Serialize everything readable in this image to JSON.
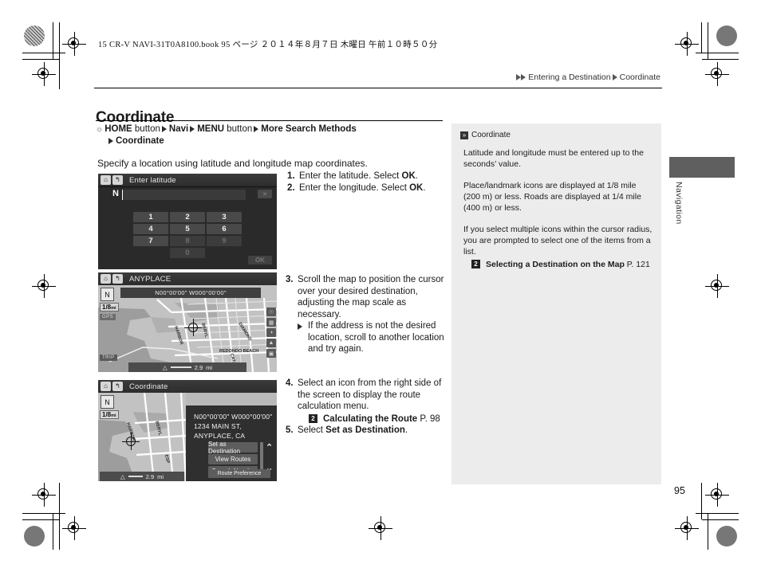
{
  "print": {
    "file_header": "15 CR-V NAVI-31T0A8100.book   95 ページ   ２０１４年８月７日   木曜日   午前１０時５０分"
  },
  "breadcrumb": {
    "items": [
      "Entering a Destination",
      "Coordinate"
    ]
  },
  "page": {
    "title": "Coordinate",
    "number": "95",
    "side_tab": "Navigation"
  },
  "nav_path": {
    "home": "HOME",
    "button_word": "button",
    "navi": "Navi",
    "menu": "MENU",
    "more_search": "More Search Methods",
    "coordinate": "Coordinate"
  },
  "intro": "Specify a location using latitude and longitude map coordinates.",
  "steps": {
    "s1_num": "1.",
    "s1_a": "Enter the latitude. Select ",
    "s1_b": "OK",
    "s1_c": ".",
    "s2_num": "2.",
    "s2_a": "Enter the longitude. Select ",
    "s2_b": "OK",
    "s2_c": ".",
    "s3_num": "3.",
    "s3_text": "Scroll the map to position the cursor over your desired destination, adjusting the map scale as necessary.",
    "s3_sub": "If the address is not the desired location, scroll to another location and try again.",
    "s4_num": "4.",
    "s4_text": "Select an icon from the right side of the screen to display the route calculation menu.",
    "s4_ref_icon": "2",
    "s4_ref_label": "Calculating the Route",
    "s4_ref_page": "P. 98",
    "s5_num": "5.",
    "s5_a": "Select ",
    "s5_b": "Set as Destination",
    "s5_c": "."
  },
  "note": {
    "icon": "»",
    "heading": "Coordinate",
    "p1": "Latitude and longitude must be entered up to the seconds’ value.",
    "p2": "Place/landmark icons are displayed at 1/8 mile (200 m) or less. Roads are displayed at 1/4 mile (400 m) or less.",
    "p3": "If you select multiple icons within the cursor radius, you are prompted to select one of the items from a list.",
    "ref_icon": "2",
    "ref_label": "Selecting a Destination on the Map",
    "ref_page": "P. 121"
  },
  "shot_latitude": {
    "home_icon": "⌂",
    "back_icon": "↰",
    "title": "Enter latitude",
    "hemisphere": "N",
    "delete_label": "✕",
    "keys": [
      "1",
      "2",
      "3",
      "4",
      "5",
      "6",
      "7",
      "8",
      "9"
    ],
    "key_zero": "0",
    "dim_keys": [
      "8",
      "9",
      "0"
    ],
    "ok_label": "OK"
  },
  "shot_map": {
    "home_icon": "⌂",
    "back_icon": "↰",
    "title": "ANYPLACE",
    "coordinates": "N00°00'00\"  W000°00'00\"",
    "compass_icon": "N",
    "scale": "1/8",
    "scale_unit": "mi",
    "gps_badge": "GPS",
    "trip_badge": "TRIP",
    "distance": "2.9",
    "distance_unit": "mi",
    "road_labels": [
      "HARBOR",
      "BERYL",
      "DIAMOND",
      "REDONDO BEACH",
      "CATALINA"
    ],
    "side_icons": [
      "route-icon",
      "poi-icon",
      "info-icon",
      "terrain-icon",
      "list-icon"
    ]
  },
  "shot_coordinate": {
    "home_icon": "⌂",
    "back_icon": "↰",
    "title": "Coordinate",
    "compass_icon": "N",
    "scale": "1/8",
    "scale_unit": "mi",
    "coordinates": "N00°00'00\"  W000°00'00\"",
    "address": "1234 MAIN ST, ANYPLACE, CA",
    "distance": "2.9",
    "distance_unit": "mi",
    "menu_items": [
      "Set as Destination",
      "View Routes",
      "Search Nearby"
    ],
    "scroll_up": "⌃",
    "scroll_down": "⌄",
    "route_preference": "Route Preference",
    "road_labels": [
      "HARBOR",
      "BERYL",
      "ESP"
    ]
  }
}
